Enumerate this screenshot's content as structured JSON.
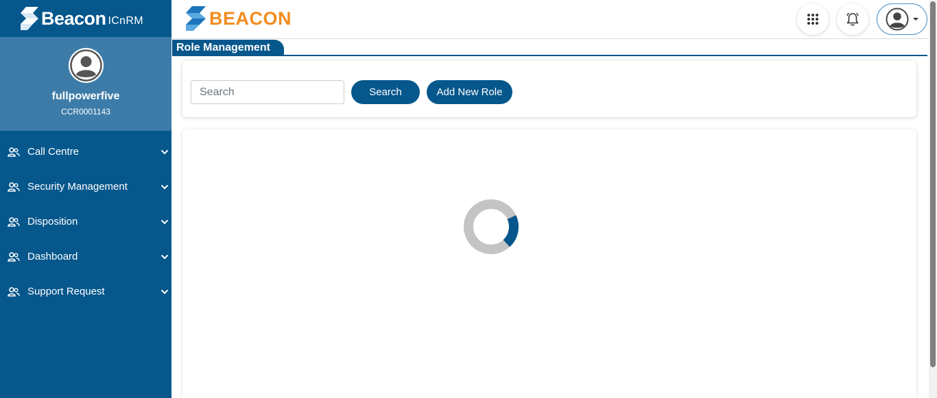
{
  "sidebar": {
    "brand_name": "Beacon",
    "brand_sub": "ICnRM",
    "user": {
      "name": "fullpowerfive",
      "id": "CCR0001143"
    },
    "items": [
      {
        "label": "Call Centre"
      },
      {
        "label": "Security Management"
      },
      {
        "label": "Disposition"
      },
      {
        "label": "Dashboard"
      },
      {
        "label": "Support Request"
      }
    ]
  },
  "header": {
    "logo_text": "BEACON",
    "icons": [
      "apps-grid-icon",
      "bell-icon",
      "user-avatar-icon"
    ]
  },
  "page": {
    "section_title": "Role Management",
    "search_placeholder": "Search",
    "search_value": "",
    "search_button": "Search",
    "add_button": "Add New Role"
  },
  "colors": {
    "primary": "#06578c",
    "profile_bg": "#3d7ca8",
    "logo_orange": "#f28c1e",
    "logo_blue": "#1b75bb",
    "spinner_track": "#c4c4c4"
  },
  "loading": {
    "progress": 0.2
  }
}
